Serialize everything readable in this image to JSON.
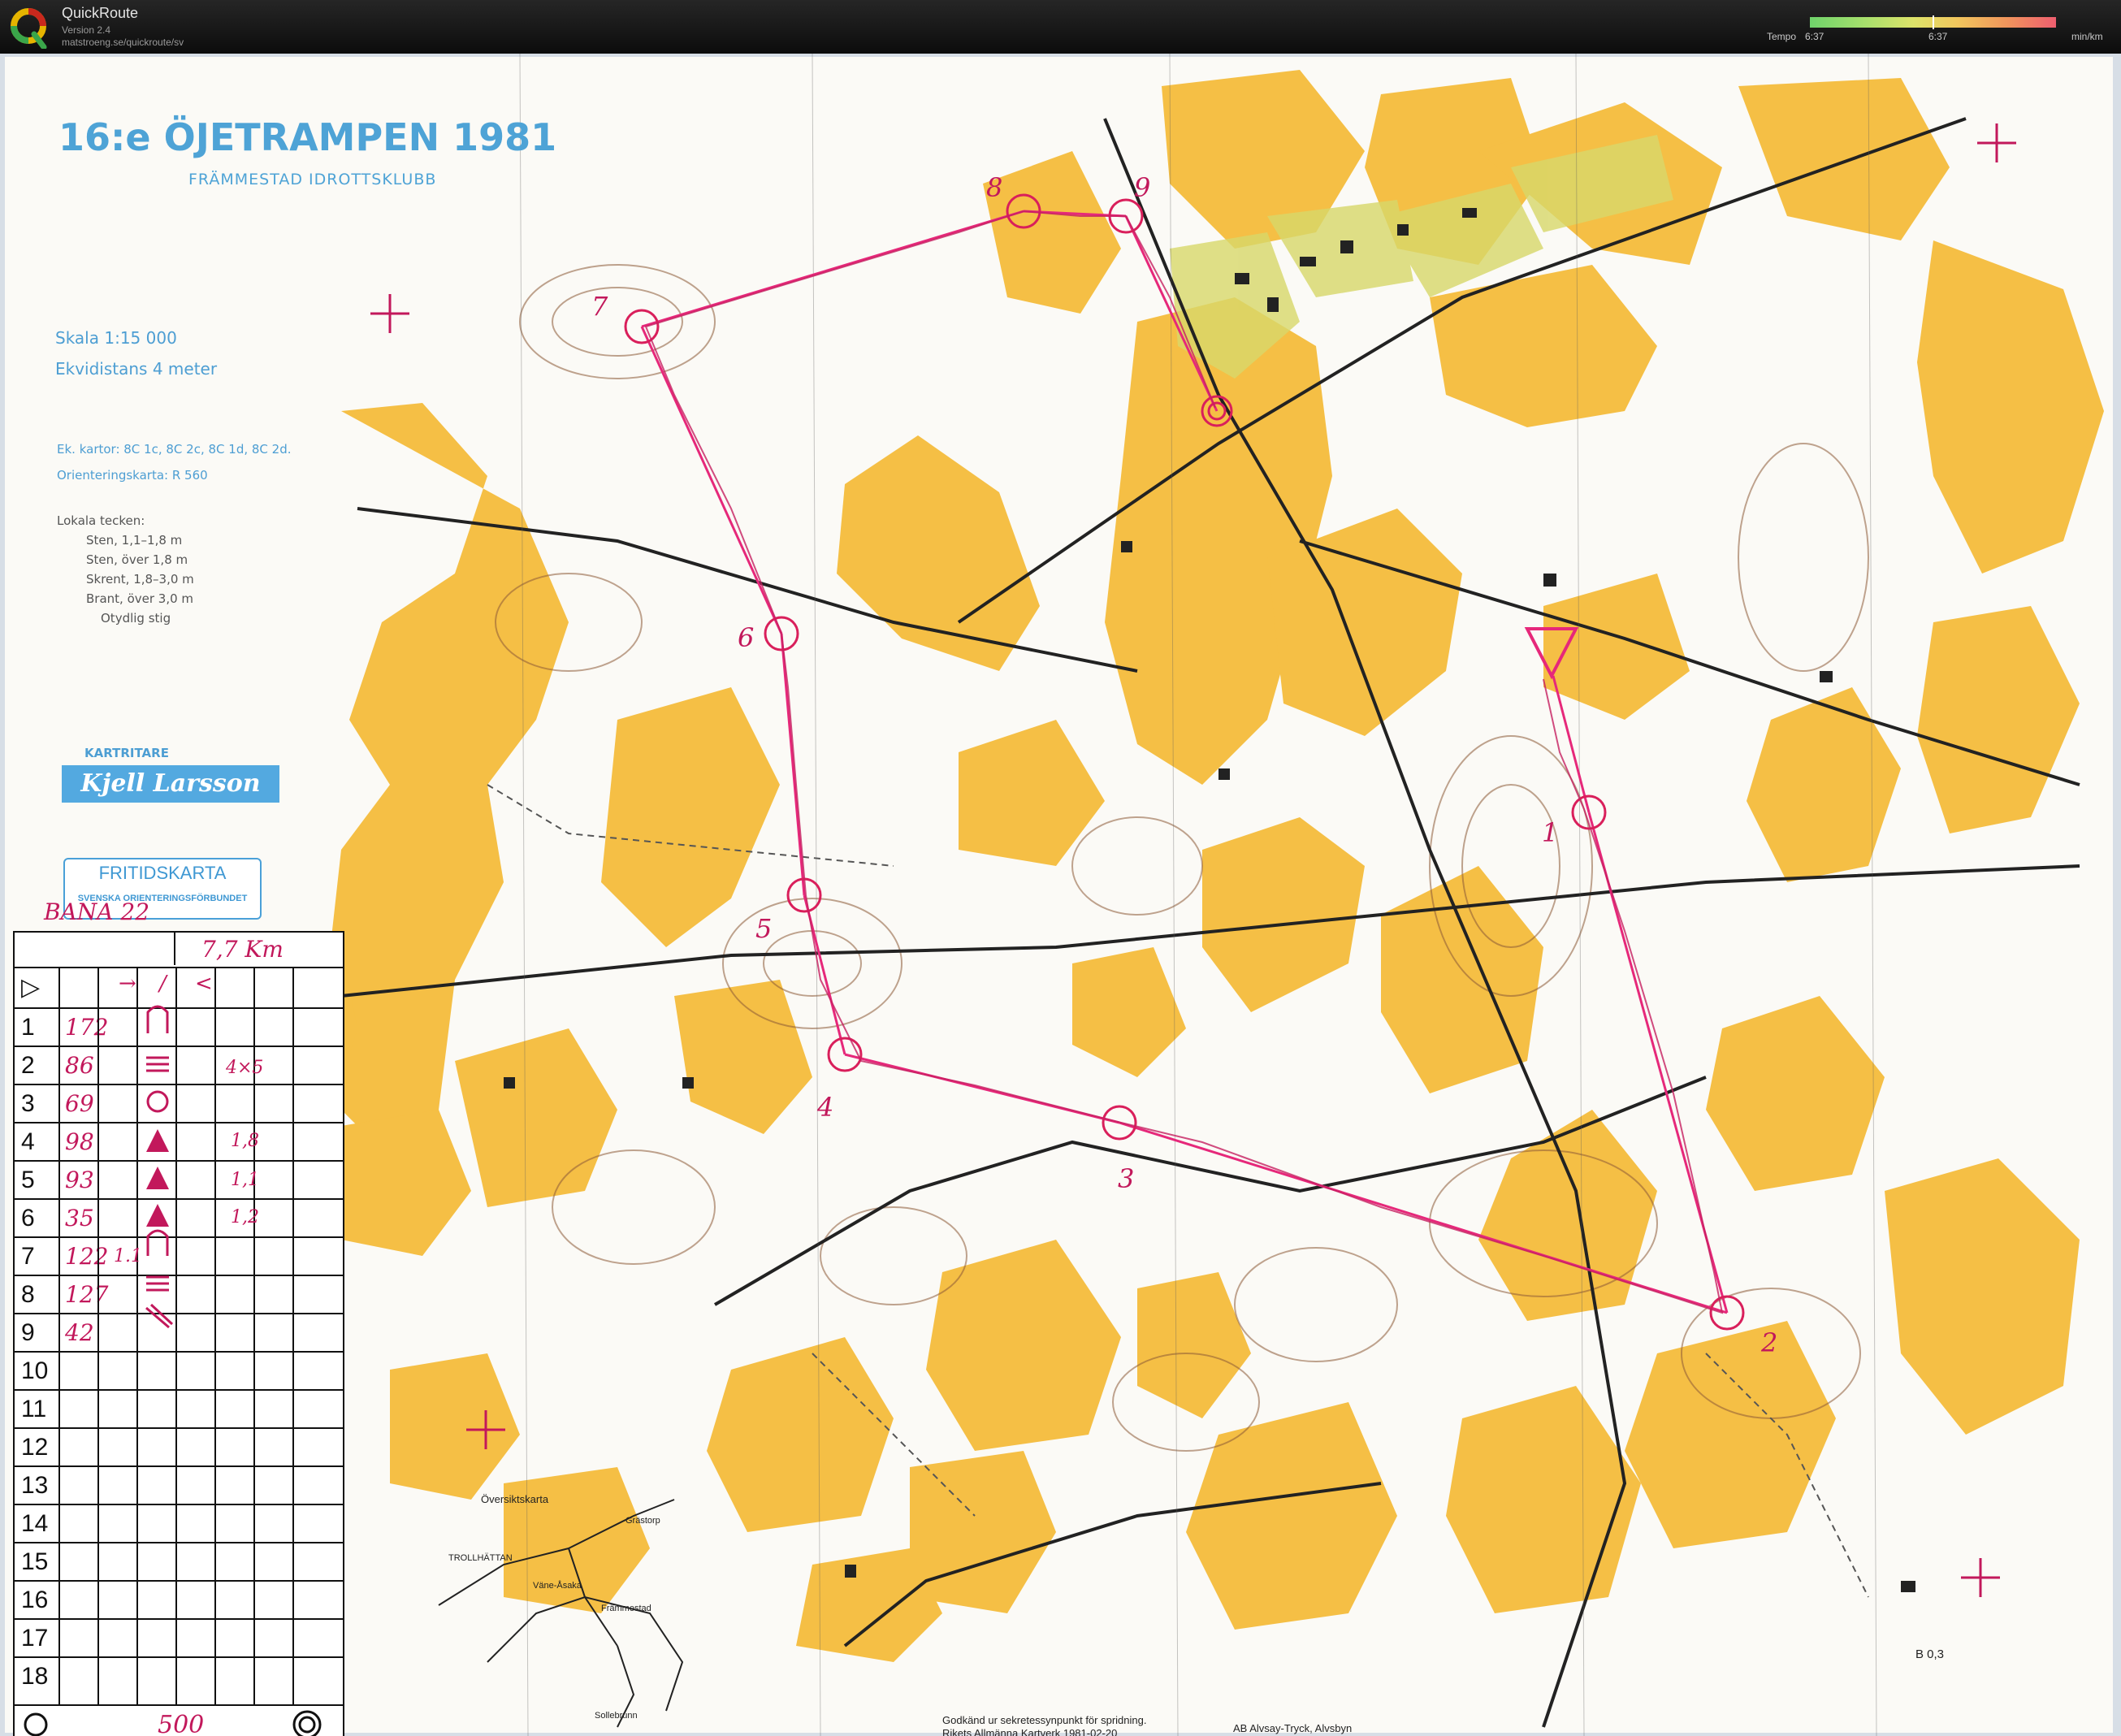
{
  "app": {
    "name": "QuickRoute",
    "version": "Version 2.4",
    "url": "matstroeng.se/quickroute/sv"
  },
  "tempo": {
    "label": "Tempo",
    "left_value": "6:37",
    "mid_value": "6:37",
    "unit": "min/km",
    "marker_fraction": 0.5
  },
  "map": {
    "title": "16:e ÖJETRAMPEN 1981",
    "club": "FRÄMMESTAD IDROTTSKLUBB",
    "scale": "Skala   1:15 000",
    "equidistance": "Ekvidistans   4 meter",
    "ek_kartor": "Ek. kartor: 8C 1c, 8C 2c, 8C 1d, 8C 2d.",
    "orient_karta": "Orienteringskarta: R 560",
    "local_symbols_title": "Lokala tecken:",
    "local_symbols": [
      "Sten, 1,1–1,8 m",
      "Sten, över 1,8 m",
      "Skrent, 1,8–3,0 m",
      "Brant, över 3,0 m",
      "Otydlig stig"
    ],
    "kartritare_label": "KARTRITARE",
    "kartritare_name": "Kjell Larsson",
    "fritidskarta": "FRITIDSKARTA",
    "forbund": "SVENSKA  ORIENTERINGSFÖRBUNDET",
    "overview_title": "Översiktskarta",
    "overview_towns": [
      "Grästorp",
      "TROLLHÄTTAN",
      "Väne-Åsaka",
      "Främmestad",
      "Sollebrunn"
    ],
    "approval_line1": "Godkänd ur sekretessynpunkt för spridning.",
    "approval_line2": "Rikets Allmänna Kartverk 1981-02-20",
    "printer": "AB Alvsay-Tryck, Alvsbyn",
    "map_code": "B 0,3"
  },
  "course": {
    "name": "BANA 22",
    "length": "7,7 Km",
    "start_symbol": "▷",
    "header_symbols": [
      "→",
      "/",
      "<"
    ],
    "rows": [
      {
        "n": "1",
        "code": "172"
      },
      {
        "n": "2",
        "code": "86"
      },
      {
        "n": "3",
        "code": "69"
      },
      {
        "n": "4",
        "code": "98"
      },
      {
        "n": "5",
        "code": "93"
      },
      {
        "n": "6",
        "code": "35"
      },
      {
        "n": "7",
        "code": "122"
      },
      {
        "n": "8",
        "code": "127"
      },
      {
        "n": "9",
        "code": "42"
      },
      {
        "n": "10",
        "code": ""
      },
      {
        "n": "11",
        "code": ""
      },
      {
        "n": "12",
        "code": ""
      },
      {
        "n": "13",
        "code": ""
      },
      {
        "n": "14",
        "code": ""
      },
      {
        "n": "15",
        "code": ""
      },
      {
        "n": "16",
        "code": ""
      },
      {
        "n": "17",
        "code": ""
      },
      {
        "n": "18",
        "code": ""
      }
    ],
    "notes": {
      "r2": "4×5",
      "r4": "1,8",
      "r5": "1,1",
      "r6": "1,2",
      "r7": "1.1"
    },
    "finish_distance": "500",
    "control_labels": [
      "1",
      "2",
      "3",
      "4",
      "5",
      "6",
      "7",
      "8",
      "9"
    ]
  }
}
